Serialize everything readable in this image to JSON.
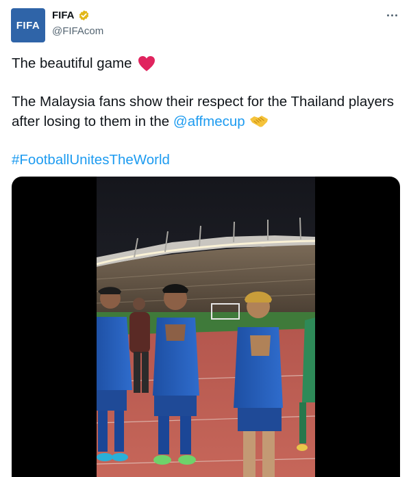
{
  "author": {
    "avatar_text": "FIFA",
    "display_name": "FIFA",
    "handle": "@FIFAcom"
  },
  "tweet": {
    "line1": "The beautiful game",
    "para2_part1": "The Malaysia fans show their respect for the Thailand players after losing to them in the ",
    "mention": "@affmecup",
    "hashtag": "#FootballUnitesTheWorld"
  },
  "icons": {
    "verified": "verified-badge-icon",
    "heart": "red-heart-icon",
    "handshake": "handshake-icon",
    "more": "more-options-icon"
  },
  "colors": {
    "link": "#1d9bf0",
    "verified_gold": "#e2b719",
    "heart_red": "#e0245e",
    "avatar_blue": "#2f64a8"
  }
}
